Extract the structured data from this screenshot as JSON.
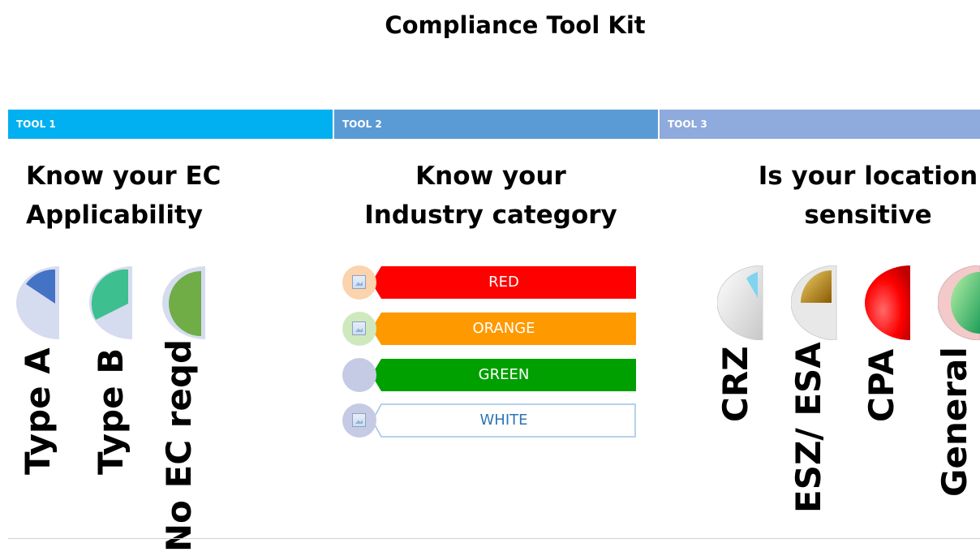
{
  "title": "Compliance Tool Kit",
  "tools": [
    {
      "label": "TOOL 1",
      "color": "#00b0f0",
      "heading_line1": "Know your EC",
      "heading_line2": "Applicability"
    },
    {
      "label": "TOOL 2",
      "color": "#5b9bd5",
      "heading_line1": "Know your",
      "heading_line2": "Industry category"
    },
    {
      "label": "TOOL 3",
      "color": "#8faadc",
      "heading_line1": "Is your location",
      "heading_line2": "sensitive"
    }
  ],
  "ec_types": [
    {
      "label": "Type A",
      "color": "#4472c4",
      "icon": "pie-quarter-icon"
    },
    {
      "label": "Type B",
      "color": "#3dbf8f",
      "icon": "pie-third-icon"
    },
    {
      "label": "No EC reqd",
      "color": "#70ad47",
      "icon": "half-circle-icon"
    }
  ],
  "categories": [
    {
      "label": "RED",
      "color": "#ff0000"
    },
    {
      "label": "ORANGE",
      "color": "#ff9900"
    },
    {
      "label": "GREEN",
      "color": "#00a000"
    },
    {
      "label": "WHITE",
      "color": "#ffffff"
    }
  ],
  "locations": [
    {
      "label": "CRZ",
      "color": "#3ab7e8",
      "icon": "silver-gauge-icon"
    },
    {
      "label": "ESZ/ ESA",
      "color": "#b8860b",
      "icon": "gold-gauge-icon"
    },
    {
      "label": "CPA",
      "color": "#ff1a1a",
      "icon": "red-gauge-icon"
    },
    {
      "label": "General",
      "color": "#3cb371",
      "icon": "green-gauge-icon"
    }
  ]
}
